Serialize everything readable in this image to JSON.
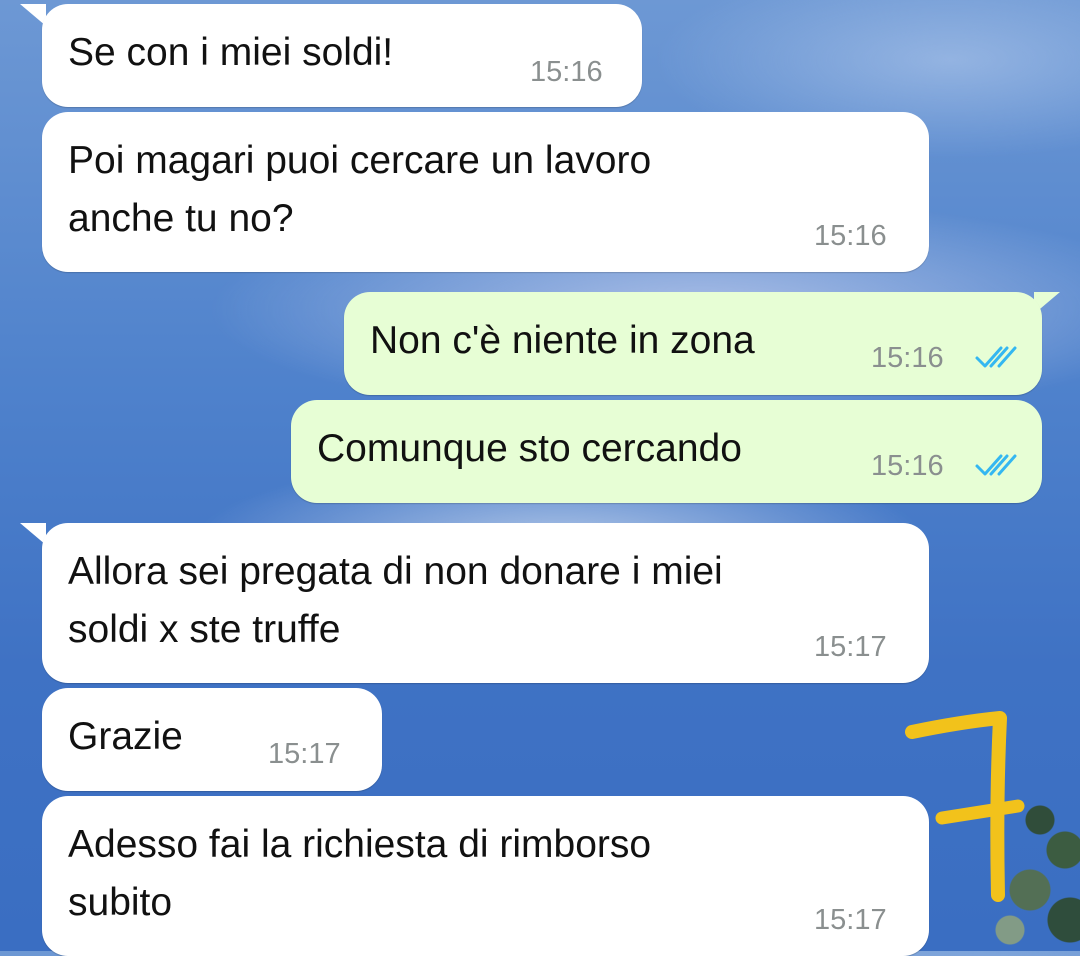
{
  "messages": [
    {
      "text": "Se con i miei soldi!",
      "time": "15:16",
      "direction": "incoming"
    },
    {
      "text": "Poi magari puoi cercare un lavoro",
      "text2": "anche tu no?",
      "time": "15:16",
      "direction": "incoming"
    },
    {
      "text": "Non c'è niente in zona",
      "time": "15:16",
      "direction": "outgoing",
      "status": "read"
    },
    {
      "text": "Comunque sto cercando",
      "time": "15:16",
      "direction": "outgoing",
      "status": "read"
    },
    {
      "text": "Allora sei pregata di non donare i miei",
      "text2": "soldi x ste truffe",
      "time": "15:17",
      "direction": "incoming"
    },
    {
      "text": "Grazie",
      "time": "15:17",
      "direction": "incoming"
    },
    {
      "text": "Adesso fai la richiesta di rimborso",
      "text2": "subito",
      "time": "15:17",
      "direction": "incoming"
    }
  ],
  "annotation": {
    "mark": "7",
    "color": "#f2c21b"
  },
  "colors": {
    "incoming_bubble": "#ffffff",
    "outgoing_bubble": "#e7fed5",
    "read_ticks": "#34b7f1"
  }
}
